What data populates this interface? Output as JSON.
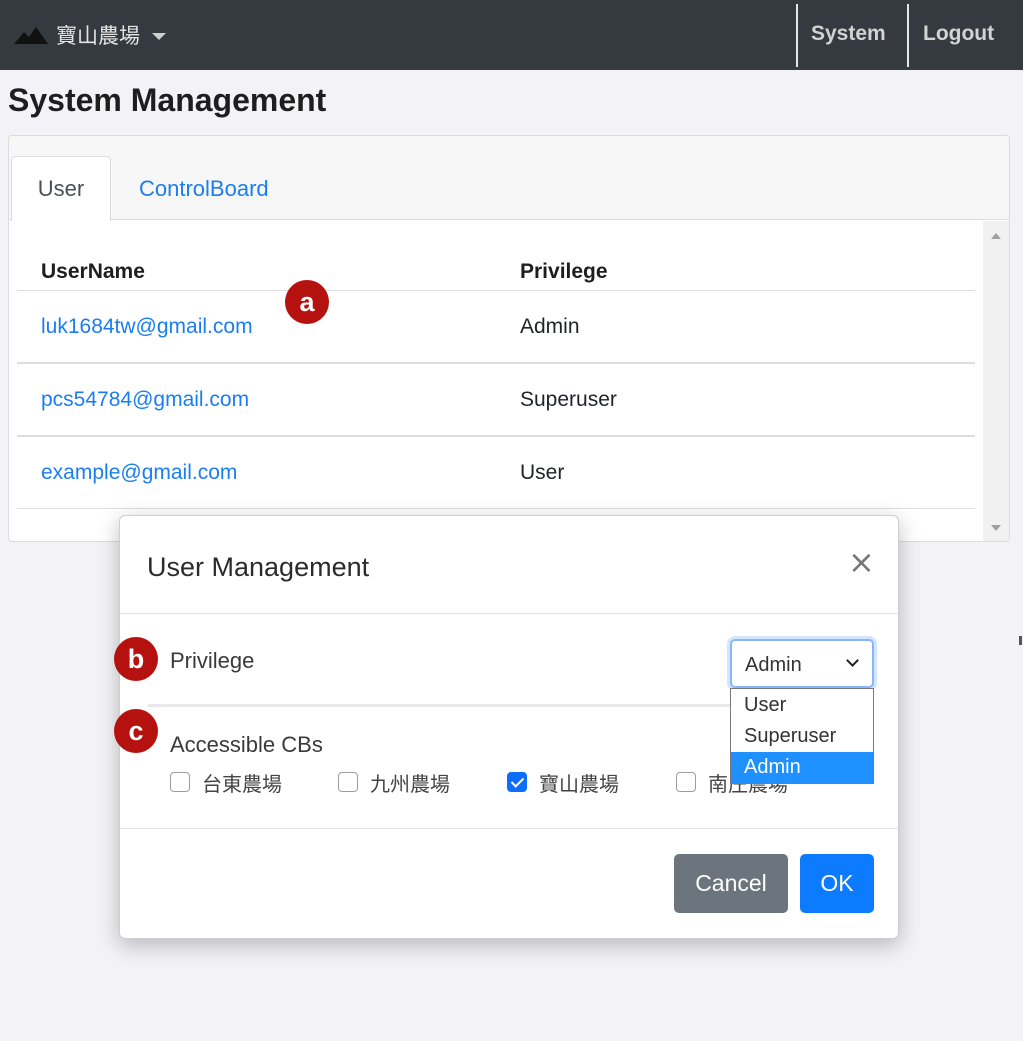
{
  "navbar": {
    "brand_label": "寶山農場",
    "system_label": "System",
    "logout_label": "Logout"
  },
  "page": {
    "title": "System Management"
  },
  "tabs": [
    {
      "label": "User",
      "active": true
    },
    {
      "label": "ControlBoard",
      "active": false
    }
  ],
  "table": {
    "headers": [
      "UserName",
      "Privilege"
    ],
    "rows": [
      {
        "username": "luk1684tw@gmail.com",
        "privilege": "Admin"
      },
      {
        "username": "pcs54784@gmail.com",
        "privilege": "Superuser"
      },
      {
        "username": "example@gmail.com",
        "privilege": "User"
      }
    ]
  },
  "markers": {
    "a": "a",
    "b": "b",
    "c": "c"
  },
  "modal": {
    "title": "User Management",
    "close_symbol": "×",
    "privilege_label": "Privilege",
    "privilege_selected": "Admin",
    "privilege_options": [
      "User",
      "Superuser",
      "Admin"
    ],
    "accessible_label": "Accessible CBs",
    "checkboxes": [
      {
        "label": "台東農場",
        "checked": false
      },
      {
        "label": "九州農場",
        "checked": false
      },
      {
        "label": "寶山農場",
        "checked": true
      },
      {
        "label": "南庄農場",
        "checked": false
      }
    ],
    "cancel_label": "Cancel",
    "ok_label": "OK"
  },
  "colors": {
    "navbar_bg": "#343a40",
    "link": "#1a7ef0",
    "marker": "#b5120f",
    "primary": "#0d7bff",
    "secondary": "#6c757d",
    "option_highlight": "#1e90ff"
  },
  "icons": {
    "brand": "mountain-icon",
    "close": "close-icon",
    "select": "chevron-down-icon"
  }
}
